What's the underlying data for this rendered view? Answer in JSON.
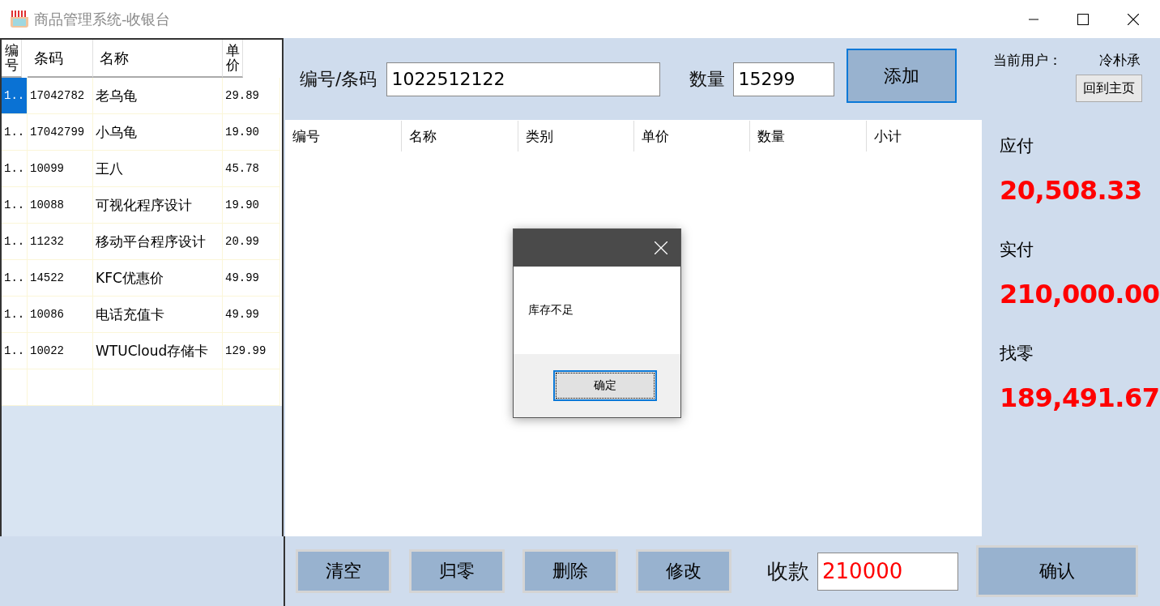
{
  "window": {
    "title": "商品管理系统-收银台"
  },
  "product_grid": {
    "columns": [
      "编号",
      "条码",
      "名称",
      "单价"
    ],
    "rows": [
      {
        "cells": [
          "1..",
          "17042782",
          "老乌龟",
          "29.89"
        ],
        "selected": true
      },
      {
        "cells": [
          "1..",
          "17042799",
          "小乌龟",
          "19.90"
        ],
        "selected": false
      },
      {
        "cells": [
          "1..",
          "10099",
          "王八",
          "45.78"
        ],
        "selected": false
      },
      {
        "cells": [
          "1..",
          "10088",
          "可视化程序设计",
          "19.90"
        ],
        "selected": false
      },
      {
        "cells": [
          "1..",
          "11232",
          "移动平台程序设计",
          "20.99"
        ],
        "selected": false
      },
      {
        "cells": [
          "1..",
          "14522",
          "KFC优惠价",
          "49.99"
        ],
        "selected": false
      },
      {
        "cells": [
          "1..",
          "10086",
          "电话充值卡",
          "49.99"
        ],
        "selected": false
      },
      {
        "cells": [
          "1..",
          "10022",
          "WTUCloud存储卡",
          "129.99"
        ],
        "selected": false
      }
    ]
  },
  "entry": {
    "code_label": "编号/条码",
    "code_value": "1022512122",
    "qty_label": "数量",
    "qty_value": "15299",
    "add_button": "添加"
  },
  "cart_table": {
    "columns": [
      "编号",
      "名称",
      "类别",
      "单价",
      "数量",
      "小计"
    ]
  },
  "user": {
    "label": "当前用户：",
    "name": "冷朴承",
    "home_button": "回到主页"
  },
  "totals": [
    {
      "label": "应付",
      "value": "20,508.33"
    },
    {
      "label": "实付",
      "value": "210,000.00"
    },
    {
      "label": "找零",
      "value": "189,491.67"
    }
  ],
  "bottom_buttons": [
    "清空",
    "归零",
    "删除",
    "修改"
  ],
  "payment": {
    "label": "收款",
    "value": "210000"
  },
  "confirm_button": "确认",
  "dialog": {
    "message": "库存不足",
    "ok_button": "确定"
  }
}
